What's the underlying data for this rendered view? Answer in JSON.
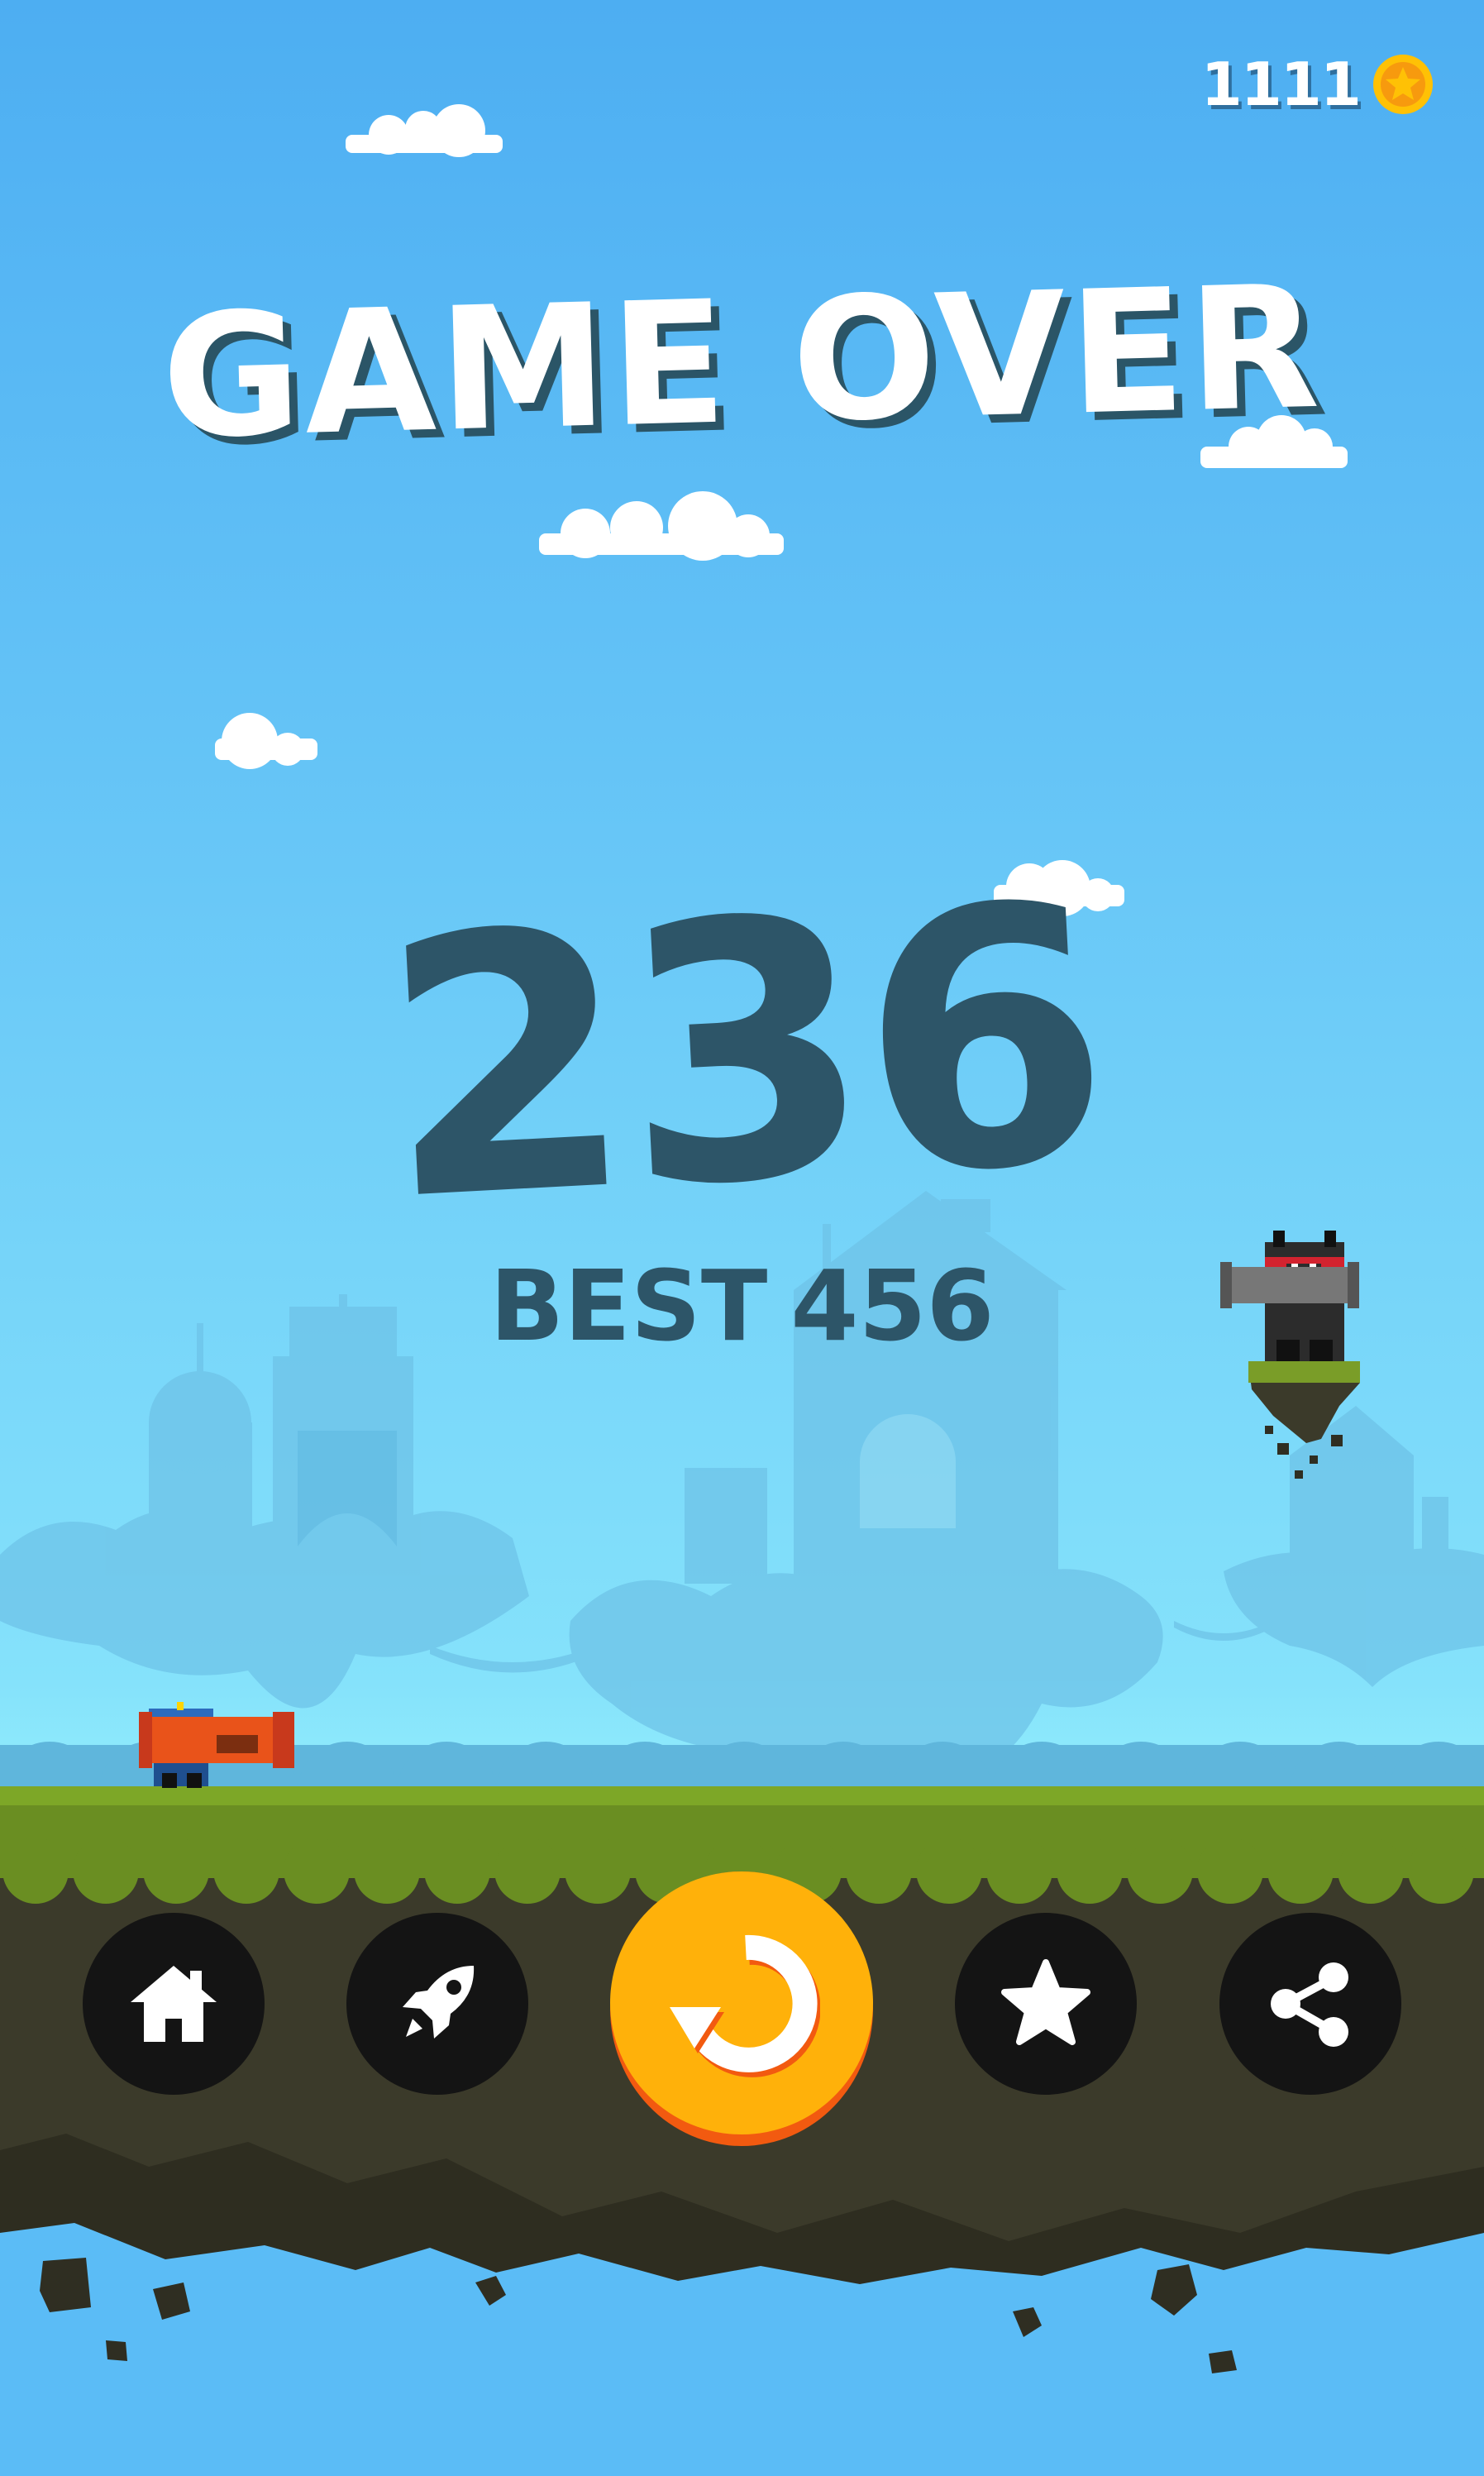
{
  "header": {
    "coins": "1111",
    "coin_icon": "coin-star-icon"
  },
  "title": "GAME OVER",
  "score": {
    "value": "236",
    "best_label": "BEST",
    "best_value": "456"
  },
  "buttons": [
    {
      "name": "home-button",
      "icon": "home-icon"
    },
    {
      "name": "upgrade-button",
      "icon": "rocket-icon"
    },
    {
      "name": "restart-button",
      "icon": "restart-icon"
    },
    {
      "name": "rate-button",
      "icon": "star-icon"
    },
    {
      "name": "share-button",
      "icon": "share-icon"
    }
  ],
  "colors": {
    "sky_top": "#4daef2",
    "sky_bottom": "#90ecfc",
    "score_text": "#2d5568",
    "restart_button": "#ffb10a",
    "restart_button_shadow": "#f25a10",
    "grass": "#6a8e22",
    "soil": "#3b3a2a",
    "dark_button": "#141414",
    "coin": "#ffc105"
  }
}
